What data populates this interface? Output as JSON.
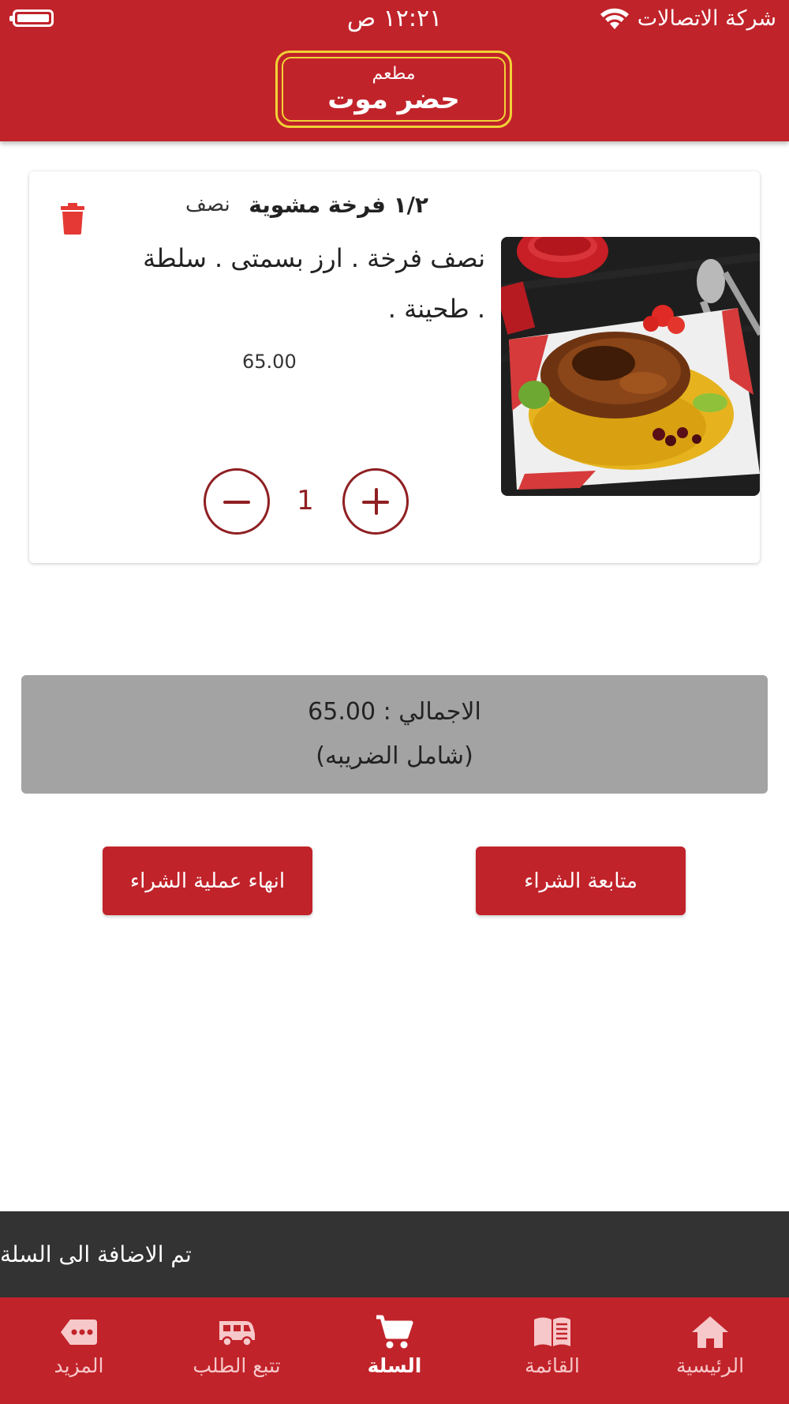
{
  "status_bar": {
    "carrier": "شركة الاتصالات",
    "time": "١٢:٢١ ص",
    "battery_level": 1.0
  },
  "header": {
    "logo_top": "مطعم",
    "logo_main": "حضر موت"
  },
  "cart": {
    "items": [
      {
        "name": "١/٢ فرخة مشوية",
        "size": "نصف",
        "description": "نصف فرخة . ارز بسمتى . سلطة . طحينة .",
        "price": "65.00",
        "quantity": "1"
      }
    ]
  },
  "summary": {
    "total_line": "الاجمالي : 65.00",
    "tax_note": "(شامل الضريبه)"
  },
  "actions": {
    "continue_label": "متابعة الشراء",
    "finish_label": "انهاء عملية الشراء"
  },
  "snackbar": {
    "message": "تم الاضافة الى السلة"
  },
  "bottom_nav": {
    "items": [
      {
        "label": "الرئيسية",
        "icon": "home-icon"
      },
      {
        "label": "القائمة",
        "icon": "menu-book-icon"
      },
      {
        "label": "السلة",
        "icon": "cart-icon",
        "active": true
      },
      {
        "label": "تتبع الطلب",
        "icon": "delivery-truck-icon"
      },
      {
        "label": "المزيد",
        "icon": "more-icon"
      }
    ]
  },
  "colors": {
    "primary": "#c1232a",
    "accent_gold": "#f1d236",
    "total_bg": "#a3a3a3",
    "snackbar_bg": "#333333",
    "quantity_control": "#8f1f22",
    "trash": "#e53935"
  }
}
